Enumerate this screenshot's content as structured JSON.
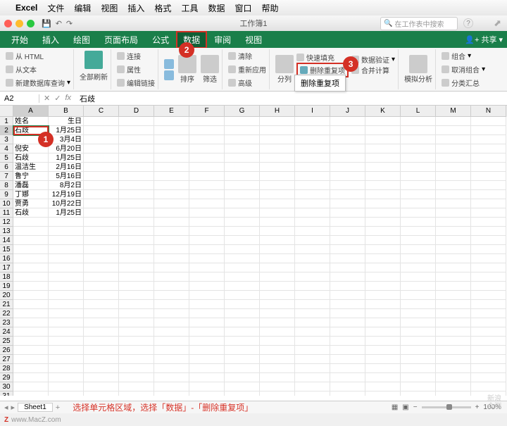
{
  "menubar": {
    "app": "Excel",
    "items": [
      "文件",
      "编辑",
      "视图",
      "插入",
      "格式",
      "工具",
      "数据",
      "窗口",
      "帮助"
    ]
  },
  "titlebar": {
    "title": "工作簿1",
    "search_placeholder": "在工作表中搜索"
  },
  "tabs": [
    "开始",
    "插入",
    "绘图",
    "页面布局",
    "公式",
    "数据",
    "审阅",
    "视图"
  ],
  "active_tab_index": 5,
  "share_label": "共享",
  "ribbon": {
    "group1": {
      "from_html": "从 HTML",
      "from_text": "从文本",
      "new_db_query": "新建数据库查询"
    },
    "group2": {
      "refresh_all": "全部刷新",
      "connections": "连接",
      "properties": "属性",
      "edit_links": "编辑链接"
    },
    "group3": {
      "sort": "排序",
      "filter": "筛选",
      "clear": "清除",
      "reapply": "重新应用",
      "advanced": "高级"
    },
    "group4": {
      "split_col": "分列",
      "flash_fill": "快速填充",
      "remove_dup": "删除重复项",
      "data_validation": "数据验证",
      "consolidate": "合并计算"
    },
    "group5": {
      "whatif": "模拟分析"
    },
    "group6": {
      "group": "组合",
      "ungroup": "取消组合",
      "subtotal": "分类汇总"
    }
  },
  "tooltip_text": "删除重复项",
  "formula": {
    "namebox": "A2",
    "fx": "石歧"
  },
  "columns": [
    "A",
    "B",
    "C",
    "D",
    "E",
    "F",
    "G",
    "H",
    "I",
    "J",
    "K",
    "L",
    "M",
    "N"
  ],
  "rows": [
    {
      "n": 1,
      "a": "姓名",
      "b": "生日"
    },
    {
      "n": 2,
      "a": "石歧",
      "b": "1月25日"
    },
    {
      "n": 3,
      "a": "",
      "b": "3月4日"
    },
    {
      "n": 4,
      "a": "倪安",
      "b": "6月20日"
    },
    {
      "n": 5,
      "a": "石歧",
      "b": "1月25日"
    },
    {
      "n": 6,
      "a": "温洁生",
      "b": "2月16日"
    },
    {
      "n": 7,
      "a": "鲁宁",
      "b": "5月16日"
    },
    {
      "n": 8,
      "a": "潘磊",
      "b": "8月2日"
    },
    {
      "n": 9,
      "a": "丁娜",
      "b": "12月19日"
    },
    {
      "n": 10,
      "a": "贾勇",
      "b": "10月22日"
    },
    {
      "n": 11,
      "a": "石歧",
      "b": "1月25日"
    }
  ],
  "empty_row_count": 21,
  "badges": {
    "1": "1",
    "2": "2",
    "3": "3"
  },
  "sheet_tab": "Sheet1",
  "annotation": "选择单元格区域，选择「数据」-「删除重复项」",
  "zoom": {
    "minus": "−",
    "plus": "+",
    "pct": "100%"
  },
  "footer_url": "www.MacZ.com",
  "watermark": {
    "l1": "新浪",
    "l2": "众测"
  }
}
